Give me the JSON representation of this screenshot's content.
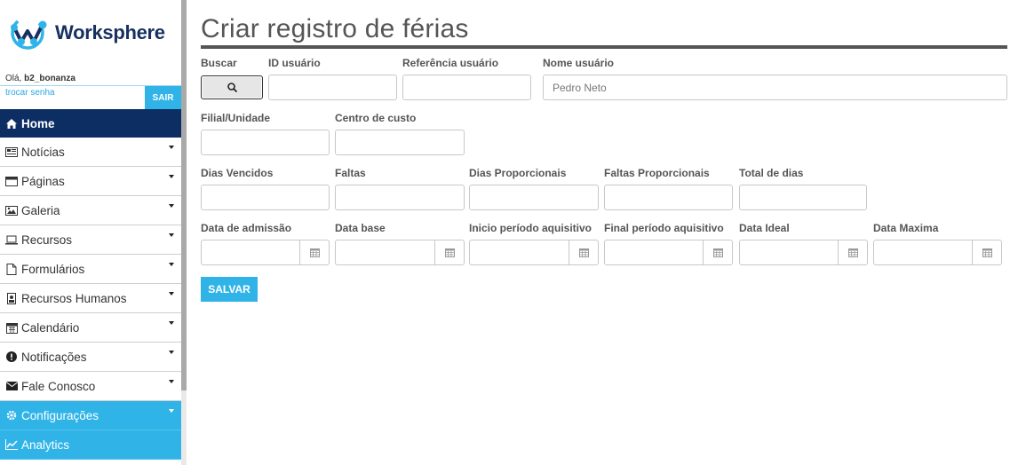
{
  "brand": {
    "name": "Worksphere",
    "accent": "#30b4e8",
    "navy": "#0c2e63"
  },
  "user": {
    "greeting": "Olá, ",
    "username": "b2_bonanza",
    "change_password": "trocar senha",
    "logout": "SAIR"
  },
  "menu": [
    {
      "label": "Home",
      "icon": "home-icon"
    },
    {
      "label": "Notícias",
      "icon": "newspaper-icon"
    },
    {
      "label": "Páginas",
      "icon": "window-icon"
    },
    {
      "label": "Galeria",
      "icon": "image-icon"
    },
    {
      "label": "Recursos",
      "icon": "laptop-icon"
    },
    {
      "label": "Formulários",
      "icon": "file-icon"
    },
    {
      "label": "Recursos Humanos",
      "icon": "id-badge-icon"
    },
    {
      "label": "Calendário",
      "icon": "calendar-icon"
    },
    {
      "label": "Notificações",
      "icon": "exclamation-circle-icon"
    },
    {
      "label": "Fale Conosco",
      "icon": "envelope-icon"
    },
    {
      "label": "Configurações",
      "icon": "gear-icon"
    },
    {
      "label": "Analytics",
      "icon": "line-chart-icon"
    }
  ],
  "page": {
    "title": "Criar registro de férias"
  },
  "form": {
    "search_label": "Buscar",
    "user_id": {
      "label": "ID usuário",
      "value": ""
    },
    "user_ref": {
      "label": "Referência usuário",
      "value": ""
    },
    "user_name": {
      "label": "Nome usuário",
      "value": "Pedro Neto"
    },
    "branch": {
      "label": "Filial/Unidade"
    },
    "cost_center": {
      "label": "Centro de custo"
    },
    "expired_days": {
      "label": "Dias Vencidos"
    },
    "absences": {
      "label": "Faltas"
    },
    "proportional_days": {
      "label": "Dias Proporcionais"
    },
    "proportional_absences": {
      "label": "Faltas Proporcionais"
    },
    "total_days": {
      "label": "Total de dias"
    },
    "admission_date": {
      "label": "Data de admissão"
    },
    "base_date": {
      "label": "Data base"
    },
    "acq_start": {
      "label": "Inicio período aquisitivo"
    },
    "acq_end": {
      "label": "Final período aquisitivo"
    },
    "ideal_date": {
      "label": "Data Ideal"
    },
    "max_date": {
      "label": "Data Maxima"
    },
    "save_label": "SALVAR"
  }
}
